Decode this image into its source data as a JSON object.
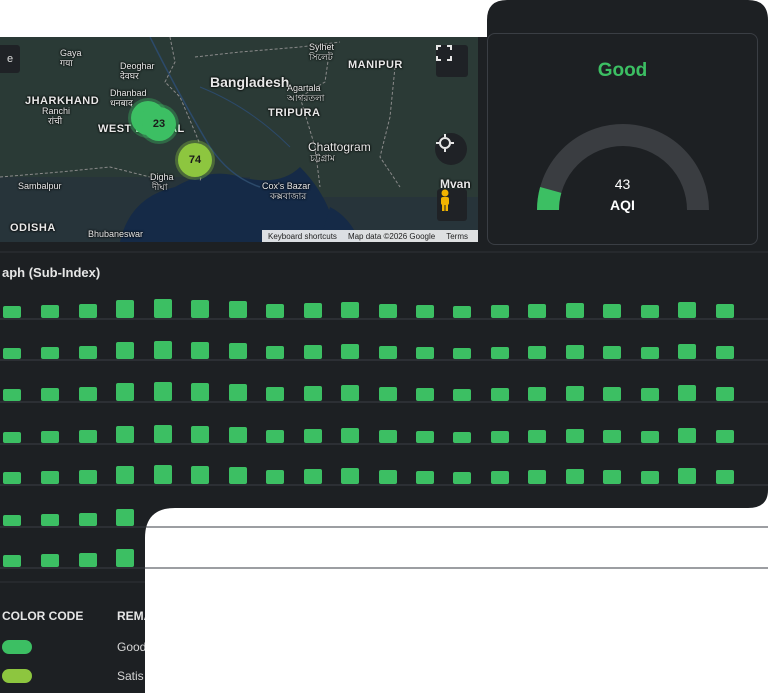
{
  "map": {
    "labels": {
      "gaya": "Gaya",
      "gaya_local": "गया",
      "deoghar": "Deoghar",
      "deoghar_local": "देवघर",
      "jharkhand": "JHARKHAND",
      "dhanbad": "Dhanbad",
      "dhanbad_local": "धनबाद",
      "ranchi": "Ranchi",
      "ranchi_local": "रांची",
      "west_bengal": "WEST BENGAL",
      "bangladesh": "Bangladesh",
      "sylhet": "Sylhet",
      "sylhet_local": "সিলেট",
      "manipur": "MANIPUR",
      "agartala": "Agartala",
      "agartala_local": "আগরতলা",
      "tripura": "TRIPURA",
      "chattogram": "Chattogram",
      "chattogram_local": "চট্টগ্রাম",
      "digha": "Digha",
      "digha_local": "দীঘা",
      "coxs_bazar": "Cox's Bazar",
      "coxs_bazar_local": "কক্সবাজার",
      "sambalpur": "Sambalpur",
      "odisha": "ODISHA",
      "bhubaneswar": "Bhubaneswar",
      "myanmar": "Mvan"
    },
    "clusters": [
      {
        "label": "",
        "color": "#3cbf63"
      },
      {
        "label": "23",
        "color": "#3cbf63"
      },
      {
        "label": "74",
        "color": "#8dc63f"
      }
    ],
    "controls": {
      "fullscreen_icon": "fullscreen-icon",
      "location_icon": "my-location-icon",
      "pegman_icon": "pegman-icon",
      "edge_button": "e"
    },
    "attribution": {
      "shortcuts": "Keyboard shortcuts",
      "data": "Map data ©2026 Google",
      "terms": "Terms"
    }
  },
  "aqi": {
    "status": "Good",
    "value": "43",
    "unit": "AQI",
    "gauge_fraction": 0.086,
    "status_color": "#3cbf63"
  },
  "graph": {
    "title": "aph (Sub-Index)",
    "bar_color": "#3cbf63",
    "row_count": 7
  },
  "legend": {
    "header_color": "COLOR CODE",
    "header_remark": "REMA",
    "items": [
      {
        "color": "#3cbf63",
        "remark": "Good"
      },
      {
        "color": "#8dc63f",
        "remark": "Satis"
      }
    ]
  },
  "colors": {
    "panel_bg": "#1d2023",
    "border": "#3a3e44",
    "good": "#3cbf63",
    "satisfactory": "#8dc63f"
  }
}
